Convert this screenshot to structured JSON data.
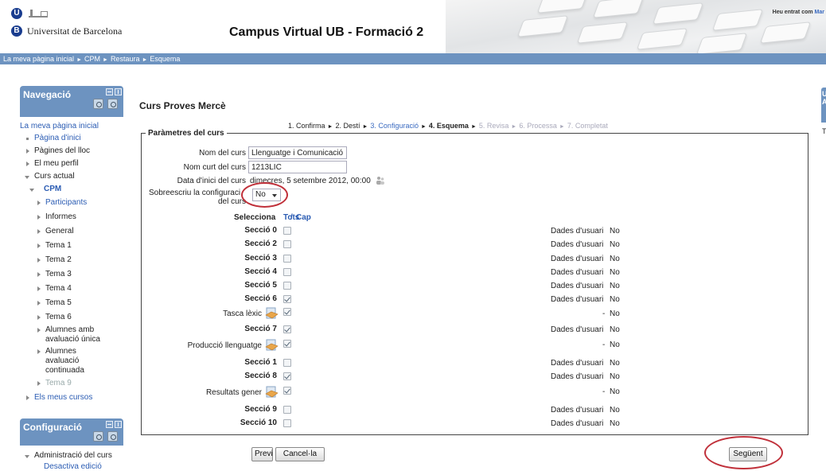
{
  "header": {
    "university": "Universitat de Barcelona",
    "logo_u": "U",
    "logo_b": "B",
    "site_title": "Campus Virtual UB - Formació 2",
    "login_prefix": "Heu entrat com ",
    "login_user": "Mar"
  },
  "breadcrumb": {
    "items": [
      "La meva pàgina inicial",
      "CPM",
      "Restaura",
      "Esquema"
    ],
    "separator": "►"
  },
  "navigation": {
    "title": "Navegació",
    "items": [
      {
        "label": "La meva pàgina inicial"
      },
      {
        "label": "Pàgina d'inici"
      },
      {
        "label": "Pàgines del lloc"
      },
      {
        "label": "El meu perfil"
      },
      {
        "label": "Curs actual"
      },
      {
        "label": "CPM"
      },
      {
        "label": "Participants"
      },
      {
        "label": "Informes"
      },
      {
        "label": "General"
      },
      {
        "label": "Tema 1"
      },
      {
        "label": "Tema 2"
      },
      {
        "label": "Tema 3"
      },
      {
        "label": "Tema 4"
      },
      {
        "label": "Tema 5"
      },
      {
        "label": "Tema 6"
      },
      {
        "label": "Alumnes amb"
      },
      {
        "label": "avaluació única"
      },
      {
        "label": "Alumnes"
      },
      {
        "label": "avaluació"
      },
      {
        "label": "continuada"
      },
      {
        "label": "Tema 9"
      },
      {
        "label": "Els meus cursos"
      }
    ]
  },
  "configuration": {
    "title": "Configuració",
    "items": [
      {
        "label": "Administració del curs"
      },
      {
        "label": "Desactiva edició"
      }
    ]
  },
  "right_block": {
    "letters": "U\nA",
    "text": "T"
  },
  "main": {
    "course_title": "Curs Proves Mercè",
    "steps": [
      {
        "label": "1. Confirma",
        "state": "done"
      },
      {
        "label": "2. Destí",
        "state": "done"
      },
      {
        "label": "3. Configuració",
        "state": "link"
      },
      {
        "label": "4. Esquema",
        "state": "current"
      },
      {
        "label": "5. Revisa",
        "state": "todo"
      },
      {
        "label": "6. Processa",
        "state": "todo"
      },
      {
        "label": "7. Completat",
        "state": "todo"
      }
    ],
    "fieldset_legend": "Paràmetres del curs",
    "fields": {
      "course_name_label": "Nom del curs",
      "course_name_value": "Llenguatge i Comunicació",
      "short_name_label": "Nom curt del curs",
      "short_name_value": "1213LIC",
      "start_date_label": "Data d'inici del curs",
      "start_date_value": "dimecres, 5 setembre 2012, 00:00",
      "overwrite_label_1": "Sobreescriu la configuraci",
      "overwrite_label_2": "del curs",
      "overwrite_value": "No"
    },
    "select": {
      "label": "Selecciona",
      "all": "Tots",
      "separator": "/",
      "none": "Cap"
    },
    "rows": [
      {
        "type": "section",
        "label": "Secció 0",
        "checked": false,
        "user_data_label": "Dades d'usuari",
        "user_data": "No"
      },
      {
        "type": "section",
        "label": "Secció 2",
        "checked": false,
        "user_data_label": "Dades d'usuari",
        "user_data": "No"
      },
      {
        "type": "section",
        "label": "Secció 3",
        "checked": false,
        "user_data_label": "Dades d'usuari",
        "user_data": "No"
      },
      {
        "type": "section",
        "label": "Secció 4",
        "checked": false,
        "user_data_label": "Dades d'usuari",
        "user_data": "No"
      },
      {
        "type": "section",
        "label": "Secció 5",
        "checked": false,
        "user_data_label": "Dades d'usuari",
        "user_data": "No"
      },
      {
        "type": "section",
        "label": "Secció 6",
        "checked": true,
        "user_data_label": "Dades d'usuari",
        "user_data": "No"
      },
      {
        "type": "activity",
        "label": "Tasca lèxic",
        "checked": true,
        "dash": "-",
        "user_data": "No"
      },
      {
        "type": "section",
        "label": "Secció 7",
        "checked": true,
        "user_data_label": "Dades d'usuari",
        "user_data": "No"
      },
      {
        "type": "activity",
        "label": "Producció llenguatge",
        "checked": true,
        "dash": "-",
        "user_data": "No"
      },
      {
        "type": "section",
        "label": "Secció 1",
        "checked": false,
        "user_data_label": "Dades d'usuari",
        "user_data": "No"
      },
      {
        "type": "section",
        "label": "Secció 8",
        "checked": true,
        "user_data_label": "Dades d'usuari",
        "user_data": "No"
      },
      {
        "type": "activity",
        "label": "Resultats gener",
        "checked": true,
        "dash": "-",
        "user_data": "No"
      },
      {
        "type": "section",
        "label": "Secció 9",
        "checked": false,
        "user_data_label": "Dades d'usuari",
        "user_data": "No"
      },
      {
        "type": "section",
        "label": "Secció 10",
        "checked": false,
        "user_data_label": "Dades d'usuari",
        "user_data": "No"
      }
    ],
    "buttons": {
      "prev": "Previ",
      "cancel": "Cancel·la",
      "next": "Següent"
    }
  },
  "colors": {
    "accent": "#6d93c0",
    "link": "#2b5cb3",
    "highlight_circle": "#c0303a"
  }
}
